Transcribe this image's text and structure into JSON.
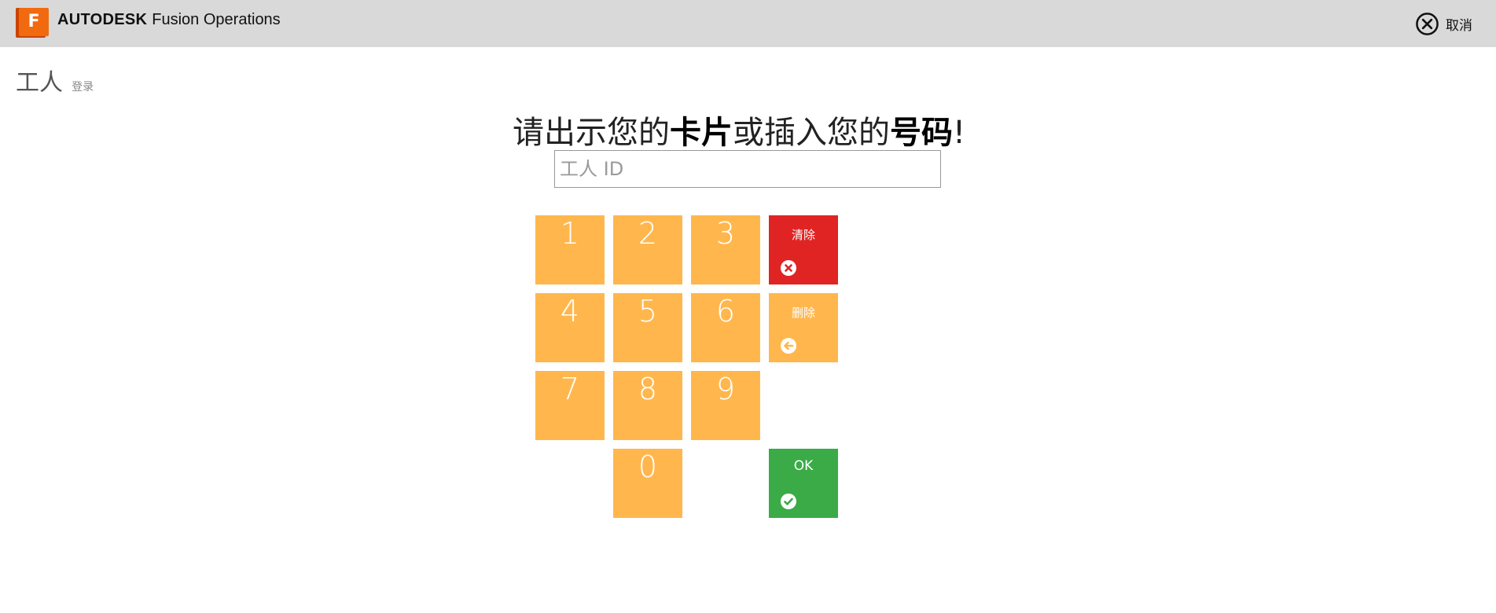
{
  "header": {
    "logo_letter": "F",
    "brand_bold": "AUTODESK",
    "brand_light": "Fusion Operations",
    "cancel_label": "取消"
  },
  "page": {
    "title": "工人",
    "subtitle": "登录"
  },
  "prompt": {
    "part1": "请出示您的",
    "bold1": "卡片",
    "part2": "或插入您的",
    "bold2": "号码",
    "end": "!"
  },
  "id_input": {
    "placeholder": "工人 ID",
    "value": ""
  },
  "keypad": {
    "digits": [
      "1",
      "2",
      "3",
      "4",
      "5",
      "6",
      "7",
      "8",
      "9",
      "0"
    ],
    "clear_label": "清除",
    "delete_label": "删除",
    "ok_label": "OK"
  },
  "colors": {
    "topbar": "#d9d9d9",
    "digit_key": "#ffb74d",
    "clear_key": "#e02424",
    "ok_key": "#3aab47",
    "logo_orange": "#f26a0f"
  },
  "icons": {
    "cancel": "close-circle-icon",
    "clear": "x-circle-icon",
    "delete": "arrow-left-circle-icon",
    "ok": "check-circle-icon"
  }
}
